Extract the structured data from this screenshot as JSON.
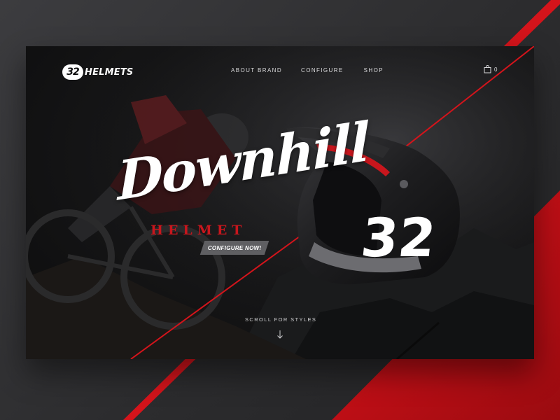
{
  "brand": {
    "badge": "32",
    "word": "HELMETS"
  },
  "nav": {
    "items": [
      "ABOUT BRAND",
      "CONFIGURE",
      "SHOP"
    ]
  },
  "cart": {
    "count": "0",
    "icon": "shopping-bag-icon"
  },
  "hero": {
    "script_title": "Downhill",
    "subtitle": "HELMET",
    "cta_label": "CONFIGURE NOW!",
    "scroll_hint": "SCROLL FOR STYLES",
    "helmet_number": "32"
  },
  "colors": {
    "accent_red": "#c8161d",
    "background_dark": "#0f0f10",
    "text_light": "#d9d9db"
  }
}
